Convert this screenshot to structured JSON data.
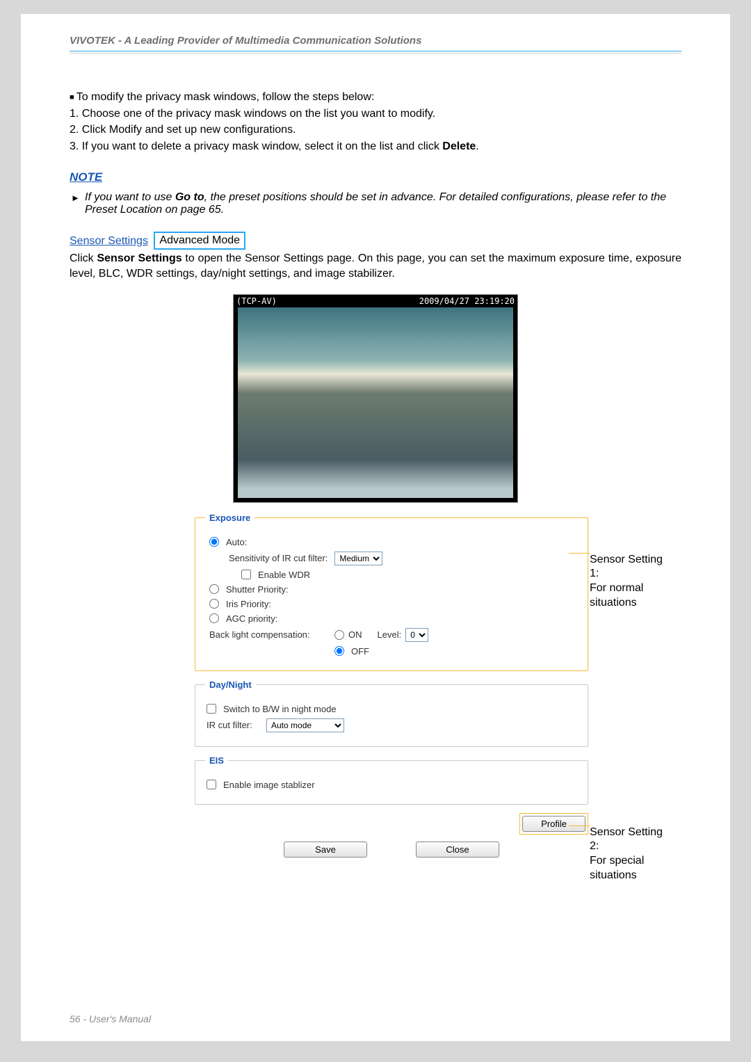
{
  "header": {
    "title": "VIVOTEK - A Leading Provider of Multimedia Communication Solutions"
  },
  "intro": {
    "bullet": "To modify the privacy mask windows, follow the steps below:",
    "step1": "1. Choose one of the privacy mask windows on the list you want to modify.",
    "step2": "2. Click Modify and set up new configurations.",
    "step3_prefix": "3. If you want to delete a privacy mask window, select it on the list and click ",
    "step3_bold": "Delete",
    "step3_suffix": "."
  },
  "note": {
    "heading": "NOTE",
    "body_prefix": "If you want to use ",
    "body_bold": "Go to",
    "body_suffix": ", the preset positions should be set in advance. For detailed configurations, please refer to the Preset Location on page 65."
  },
  "sensor": {
    "link": "Sensor Settings",
    "badge": "Advanced Mode",
    "desc_prefix": "Click ",
    "desc_bold": "Sensor Settings",
    "desc_suffix": " to open the Sensor Settings page. On this page, you can set the maximum exposure time, exposure level,  BLC, WDR settings, day/night settings, and image stabilizer."
  },
  "preview": {
    "name": "(TCP-AV)",
    "timestamp": "2009/04/27 23:19:20"
  },
  "exposure": {
    "legend": "Exposure",
    "auto_label": "Auto:",
    "ircut_sens_label": "Sensitivity of IR cut filter:",
    "ircut_sens_value": "Medium",
    "enable_wdr": "Enable WDR",
    "shutter": "Shutter Priority:",
    "iris": "Iris Priority:",
    "agc": "AGC priority:",
    "blc_label": "Back light compensation:",
    "on": "ON",
    "off": "OFF",
    "level_label": "Level:",
    "level_value": "0"
  },
  "daynight": {
    "legend": "Day/Night",
    "switch_bw": "Switch to B/W in night mode",
    "ircut_label": "IR cut filter:",
    "ircut_value": "Auto mode"
  },
  "eis": {
    "legend": "EIS",
    "enable": "Enable image stablizer"
  },
  "buttons": {
    "profile": "Profile",
    "save": "Save",
    "close": "Close"
  },
  "callouts": {
    "s1_title": "Sensor Setting 1:",
    "s1_body": "For normal situations",
    "s2_title": "Sensor Setting 2:",
    "s2_body": "For special situations"
  },
  "footer": "56 - User's Manual"
}
